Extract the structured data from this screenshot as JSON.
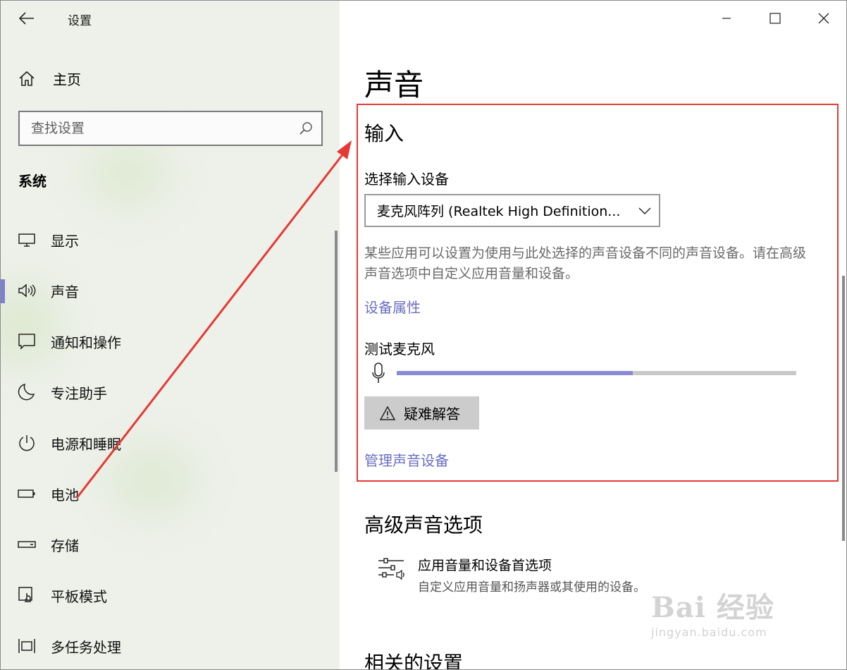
{
  "window": {
    "title": "设置",
    "back_icon": "arrow-left-icon",
    "caption_buttons": [
      "minimize-icon",
      "maximize-icon",
      "close-icon"
    ]
  },
  "sidebar": {
    "home_label": "主页",
    "search_placeholder": "查找设置",
    "section_title": "系统",
    "items": [
      {
        "label": "显示",
        "icon": "display-icon",
        "active": false
      },
      {
        "label": "声音",
        "icon": "speaker-icon",
        "active": true
      },
      {
        "label": "通知和操作",
        "icon": "notification-icon",
        "active": false
      },
      {
        "label": "专注助手",
        "icon": "moon-icon",
        "active": false
      },
      {
        "label": "电源和睡眠",
        "icon": "power-icon",
        "active": false
      },
      {
        "label": "电池",
        "icon": "battery-icon",
        "active": false
      },
      {
        "label": "存储",
        "icon": "storage-icon",
        "active": false
      },
      {
        "label": "平板模式",
        "icon": "tablet-mode-icon",
        "active": false
      },
      {
        "label": "多任务处理",
        "icon": "multitask-icon",
        "active": false
      }
    ]
  },
  "main": {
    "page_title": "声音",
    "input": {
      "heading": "输入",
      "select_label": "选择输入设备",
      "selected_device": "麦克风阵列 (Realtek High Definition...",
      "description": "某些应用可以设置为使用与此处选择的声音设备不同的声音设备。请在高级声音选项中自定义应用音量和设备。",
      "device_properties_link": "设备属性",
      "test_mic_label": "测试麦克风",
      "mic_level": 0.59,
      "troubleshoot_label": "疑难解答",
      "manage_link": "管理声音设备"
    },
    "advanced": {
      "heading": "高级声音选项",
      "item_title": "应用音量和设备首选项",
      "item_desc": "自定义应用音量和扬声器或其使用的设备。"
    },
    "related_heading": "相关的设置"
  },
  "colors": {
    "accent": "#7e7fd0",
    "link": "#6b6fc2",
    "annotation": "#e53935"
  },
  "watermark": {
    "brand": "Bai  经验",
    "url": "jingyan.baidu.com"
  }
}
